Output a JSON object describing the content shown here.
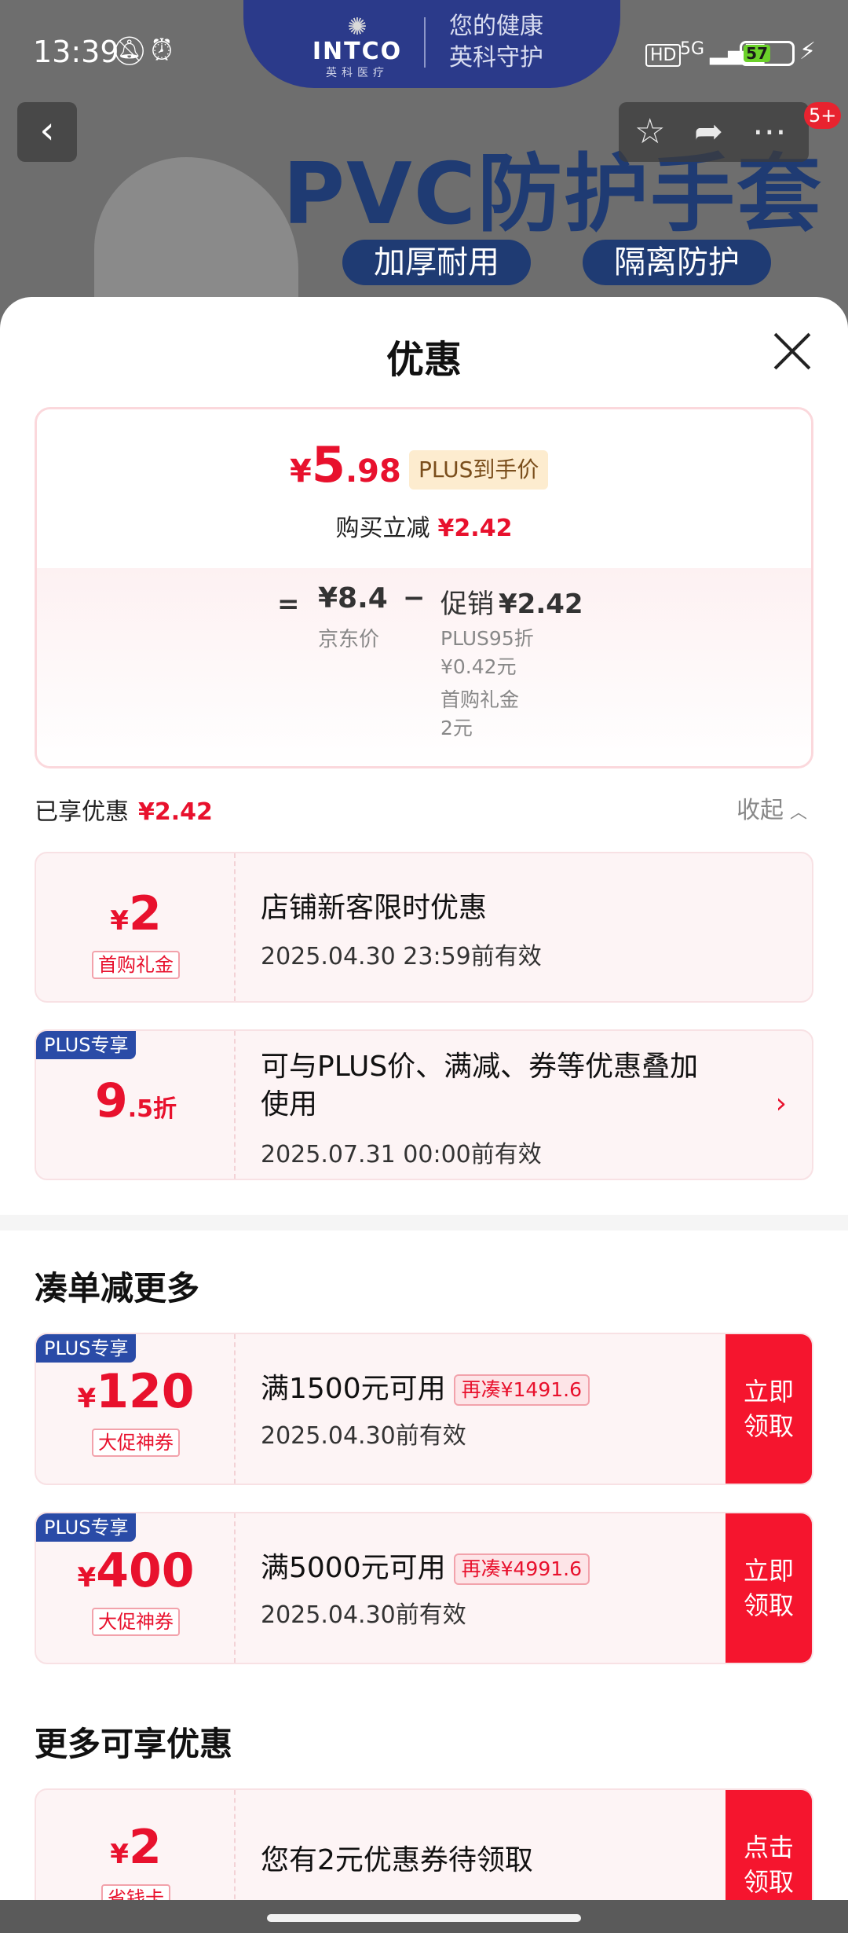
{
  "status_bar": {
    "time": "13:39",
    "network": "5G",
    "hd": "HD",
    "battery": "57",
    "battery_percent": 57
  },
  "banner": {
    "brand_name": "INTCO",
    "brand_cn": "英科医疗",
    "slogan_line1": "您的健康",
    "slogan_line2": "英科守护",
    "title": "PVC防护手套",
    "tag1": "加厚耐用",
    "tag2": "隔离防护"
  },
  "topbar": {
    "back_icon": "chevron-left-icon",
    "message_badge": "5+"
  },
  "sheet": {
    "title": "优惠",
    "summary": {
      "currency": "¥",
      "price_int": "5",
      "price_dec": ".98",
      "price_tag": "PLUS到手价",
      "reduce_label": "购买立减",
      "reduce_value": "¥2.42",
      "equals": "=",
      "jd_price": "¥8.4",
      "jd_label": "京东价",
      "minus": "−",
      "promo_label": "促销",
      "promo_value": "¥2.42",
      "promo_line1": "PLUS95折",
      "promo_line2": "¥0.42元",
      "promo_line3": "首购礼金",
      "promo_line4": "2元"
    },
    "enjoyed": {
      "label": "已享优惠",
      "value": "¥2.42",
      "collapse": "收起"
    },
    "enjoyed_cards": [
      {
        "currency": "¥",
        "amount": "2",
        "tag": "首购礼金",
        "title": "店铺新客限时优惠",
        "date": "2025.04.30 23:59前有效"
      },
      {
        "plus_tag": "PLUS专享",
        "amount": "9",
        "amount_suffix": ".5折",
        "title_line1": "可与PLUS价、满减、券等优惠叠加",
        "title_line2": "使用",
        "date": "2025.07.31 00:00前有效"
      }
    ],
    "more_title": "凑单减更多",
    "more_cards": [
      {
        "plus_tag": "PLUS专享",
        "currency": "¥",
        "amount": "120",
        "tag": "大促神券",
        "title": "满1500元可用",
        "hint": "再凑¥1491.6",
        "date": "2025.04.30前有效",
        "button": "立即领取"
      },
      {
        "plus_tag": "PLUS专享",
        "currency": "¥",
        "amount": "400",
        "tag": "大促神券",
        "title": "满5000元可用",
        "hint": "再凑¥4991.6",
        "date": "2025.04.30前有效",
        "button": "立即领取"
      }
    ],
    "extra_title": "更多可享优惠",
    "extra_cards": [
      {
        "currency": "¥",
        "amount": "2",
        "tag": "省钱卡",
        "title": "您有2元优惠券待领取",
        "button": "点击领取"
      }
    ]
  },
  "colors": {
    "accent": "#e8112d",
    "plus_blue": "#2a4ba7",
    "brand_navy": "#1f3b73"
  }
}
